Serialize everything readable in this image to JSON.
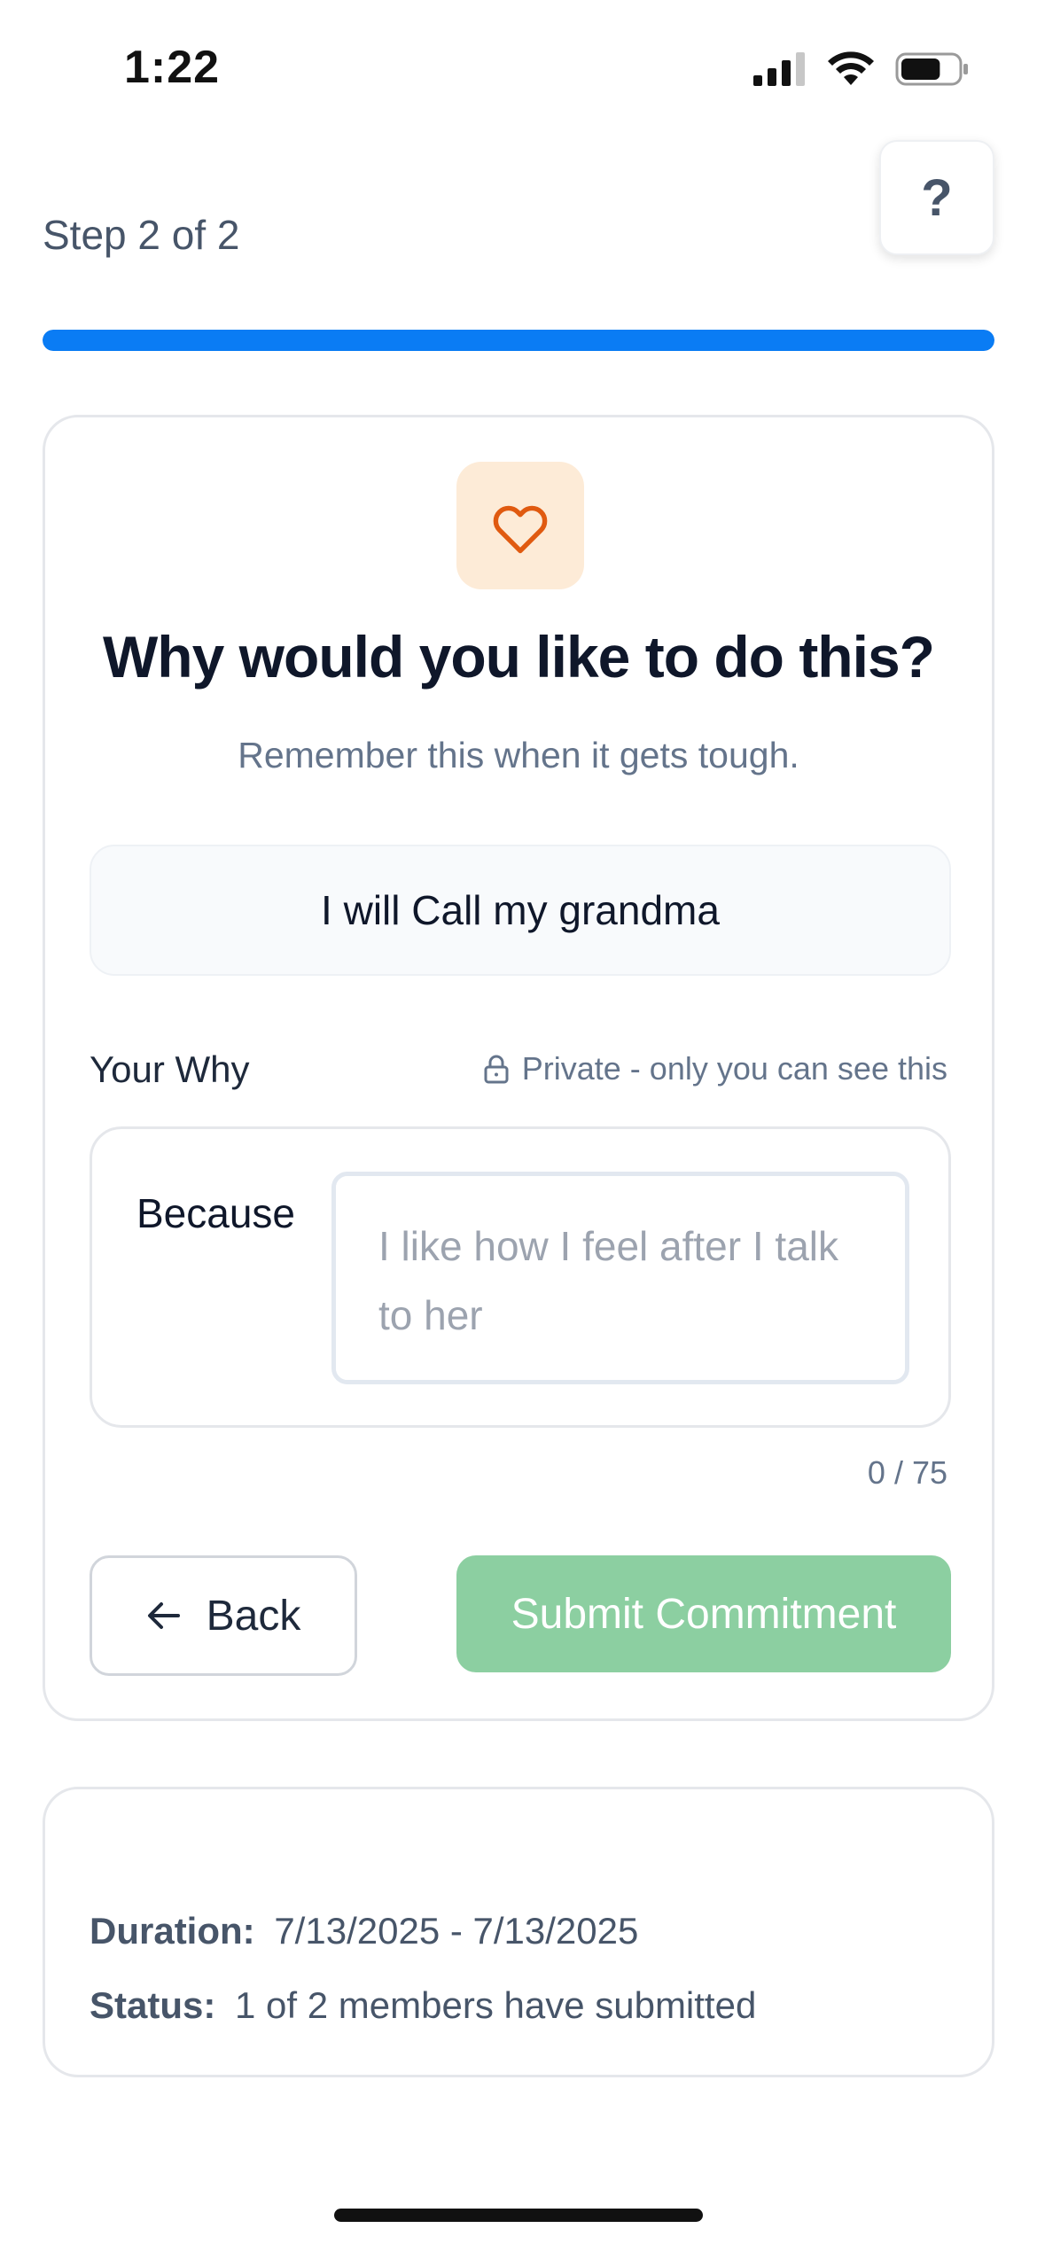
{
  "status_bar": {
    "time": "1:22",
    "battery_level": 0.7
  },
  "header": {
    "step_label": "Step 2 of 2",
    "help_label": "?",
    "progress": 1.0,
    "progress_color": "#0a7cf4"
  },
  "card": {
    "icon": "heart-icon",
    "question": "Why would you like to do this?",
    "subtitle": "Remember this when it gets tough.",
    "commitment": "I will Call my grandma",
    "why_label": "Your Why",
    "private_note": "Private - only you can see this",
    "because_label": "Because",
    "why_value": "",
    "why_placeholder": "I like how I feel after I talk to her",
    "counter": "0 / 75",
    "back_label": "Back",
    "submit_label": "Submit Commitment",
    "submit_color": "#8ccfa1"
  },
  "info": {
    "duration_label": "Duration:",
    "duration_value": "7/13/2025 - 7/13/2025",
    "status_label": "Status:",
    "status_value": "1 of 2 members have submitted"
  }
}
